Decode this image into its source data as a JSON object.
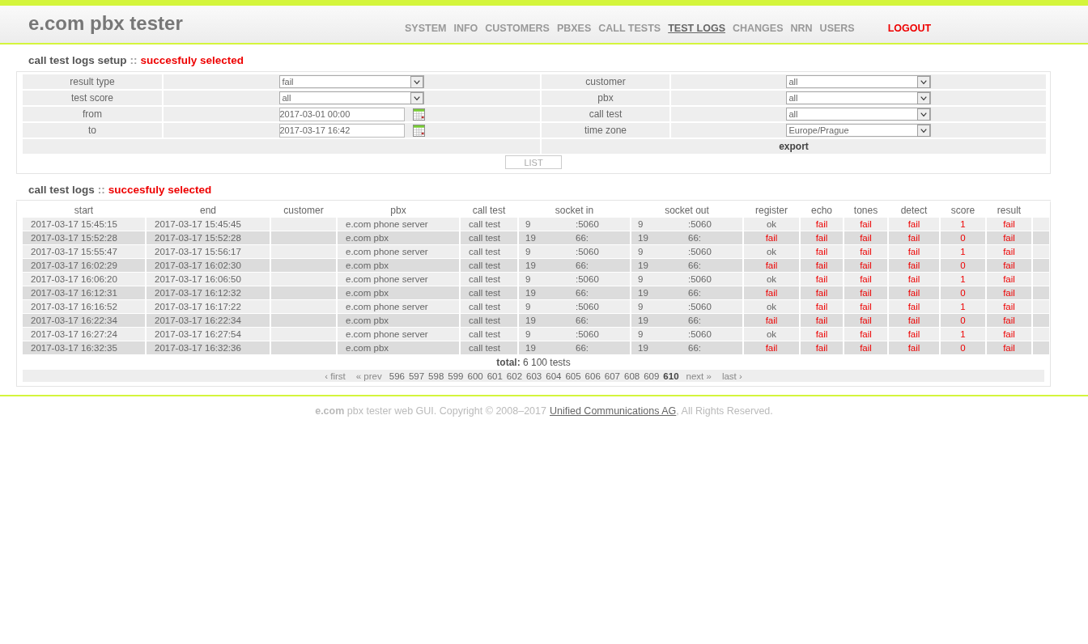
{
  "app_title": "e.com pbx tester",
  "nav": [
    {
      "label": "SYSTEM",
      "selected": false,
      "kind": "link"
    },
    {
      "label": "INFO",
      "selected": false,
      "kind": "link"
    },
    {
      "label": "CUSTOMERS",
      "selected": false,
      "kind": "link"
    },
    {
      "label": "PBXES",
      "selected": false,
      "kind": "link"
    },
    {
      "label": "CALL TESTS",
      "selected": false,
      "kind": "link"
    },
    {
      "label": "TEST LOGS",
      "selected": true,
      "kind": "link"
    },
    {
      "label": "CHANGES",
      "selected": false,
      "kind": "link"
    },
    {
      "label": "NRN",
      "selected": false,
      "kind": "link"
    },
    {
      "label": "USERS",
      "selected": false,
      "kind": "link"
    },
    {
      "label": "LOGOUT",
      "selected": false,
      "kind": "logout"
    }
  ],
  "setup": {
    "heading": "call test logs setup",
    "separator": "::",
    "status": "succesfuly selected",
    "left": [
      {
        "label": "result type",
        "kind": "select",
        "value": "fail"
      },
      {
        "label": "test score",
        "kind": "select",
        "value": "all"
      },
      {
        "label": "from",
        "kind": "date",
        "value": "2017-03-01 00:00"
      },
      {
        "label": "to",
        "kind": "date",
        "value": "2017-03-17 16:42"
      }
    ],
    "right": [
      {
        "label": "customer",
        "kind": "select",
        "value": "all"
      },
      {
        "label": "pbx",
        "kind": "select",
        "value": "all"
      },
      {
        "label": "call test",
        "kind": "select",
        "value": "all"
      },
      {
        "label": "time zone",
        "kind": "select",
        "value": "Europe/Prague"
      }
    ],
    "export": "export",
    "list_button": "LIST"
  },
  "logs": {
    "heading": "call test logs",
    "separator": "::",
    "status": "succesfuly selected",
    "columns": [
      "start",
      "end",
      "customer",
      "pbx",
      "call test",
      "socket in",
      "socket out",
      "register",
      "echo",
      "tones",
      "detect",
      "score",
      "result"
    ],
    "rows": [
      {
        "start": "2017-03-17 15:45:15",
        "end": "2017-03-17 15:45:45",
        "pbx": "e.com phone server",
        "call_test": "call test",
        "socket_in": [
          "9",
          ":5060"
        ],
        "socket_out": [
          "9",
          ":5060"
        ],
        "checks": [
          {
            "text": "ok",
            "failed": false
          },
          {
            "text": "fail",
            "failed": true
          },
          {
            "text": "fail",
            "failed": true
          },
          {
            "text": "fail",
            "failed": true
          },
          {
            "text": "1",
            "failed": true
          },
          {
            "text": "fail",
            "failed": true
          }
        ]
      },
      {
        "start": "2017-03-17 15:52:28",
        "end": "2017-03-17 15:52:28",
        "pbx": "e.com pbx",
        "call_test": "call test",
        "socket_in": [
          "19",
          "66:"
        ],
        "socket_out": [
          "19",
          "66:"
        ],
        "checks": [
          {
            "text": "fail",
            "failed": true
          },
          {
            "text": "fail",
            "failed": true
          },
          {
            "text": "fail",
            "failed": true
          },
          {
            "text": "fail",
            "failed": true
          },
          {
            "text": "0",
            "failed": true
          },
          {
            "text": "fail",
            "failed": true
          }
        ]
      },
      {
        "start": "2017-03-17 15:55:47",
        "end": "2017-03-17 15:56:17",
        "pbx": "e.com phone server",
        "call_test": "call test",
        "socket_in": [
          "9",
          ":5060"
        ],
        "socket_out": [
          "9",
          ":5060"
        ],
        "checks": [
          {
            "text": "ok",
            "failed": false
          },
          {
            "text": "fail",
            "failed": true
          },
          {
            "text": "fail",
            "failed": true
          },
          {
            "text": "fail",
            "failed": true
          },
          {
            "text": "1",
            "failed": true
          },
          {
            "text": "fail",
            "failed": true
          }
        ]
      },
      {
        "start": "2017-03-17 16:02:29",
        "end": "2017-03-17 16:02:30",
        "pbx": "e.com pbx",
        "call_test": "call test",
        "socket_in": [
          "19",
          "66:"
        ],
        "socket_out": [
          "19",
          "66:"
        ],
        "checks": [
          {
            "text": "fail",
            "failed": true
          },
          {
            "text": "fail",
            "failed": true
          },
          {
            "text": "fail",
            "failed": true
          },
          {
            "text": "fail",
            "failed": true
          },
          {
            "text": "0",
            "failed": true
          },
          {
            "text": "fail",
            "failed": true
          }
        ]
      },
      {
        "start": "2017-03-17 16:06:20",
        "end": "2017-03-17 16:06:50",
        "pbx": "e.com phone server",
        "call_test": "call test",
        "socket_in": [
          "9",
          ":5060"
        ],
        "socket_out": [
          "9",
          ":5060"
        ],
        "checks": [
          {
            "text": "ok",
            "failed": false
          },
          {
            "text": "fail",
            "failed": true
          },
          {
            "text": "fail",
            "failed": true
          },
          {
            "text": "fail",
            "failed": true
          },
          {
            "text": "1",
            "failed": true
          },
          {
            "text": "fail",
            "failed": true
          }
        ]
      },
      {
        "start": "2017-03-17 16:12:31",
        "end": "2017-03-17 16:12:32",
        "pbx": "e.com pbx",
        "call_test": "call test",
        "socket_in": [
          "19",
          "66:"
        ],
        "socket_out": [
          "19",
          "66:"
        ],
        "checks": [
          {
            "text": "fail",
            "failed": true
          },
          {
            "text": "fail",
            "failed": true
          },
          {
            "text": "fail",
            "failed": true
          },
          {
            "text": "fail",
            "failed": true
          },
          {
            "text": "0",
            "failed": true
          },
          {
            "text": "fail",
            "failed": true
          }
        ]
      },
      {
        "start": "2017-03-17 16:16:52",
        "end": "2017-03-17 16:17:22",
        "pbx": "e.com phone server",
        "call_test": "call test",
        "socket_in": [
          "9",
          ":5060"
        ],
        "socket_out": [
          "9",
          ":5060"
        ],
        "checks": [
          {
            "text": "ok",
            "failed": false
          },
          {
            "text": "fail",
            "failed": true
          },
          {
            "text": "fail",
            "failed": true
          },
          {
            "text": "fail",
            "failed": true
          },
          {
            "text": "1",
            "failed": true
          },
          {
            "text": "fail",
            "failed": true
          }
        ]
      },
      {
        "start": "2017-03-17 16:22:34",
        "end": "2017-03-17 16:22:34",
        "pbx": "e.com pbx",
        "call_test": "call test",
        "socket_in": [
          "19",
          "66:"
        ],
        "socket_out": [
          "19",
          "66:"
        ],
        "checks": [
          {
            "text": "fail",
            "failed": true
          },
          {
            "text": "fail",
            "failed": true
          },
          {
            "text": "fail",
            "failed": true
          },
          {
            "text": "fail",
            "failed": true
          },
          {
            "text": "0",
            "failed": true
          },
          {
            "text": "fail",
            "failed": true
          }
        ]
      },
      {
        "start": "2017-03-17 16:27:24",
        "end": "2017-03-17 16:27:54",
        "pbx": "e.com phone server",
        "call_test": "call test",
        "socket_in": [
          "9",
          ":5060"
        ],
        "socket_out": [
          "9",
          ":5060"
        ],
        "checks": [
          {
            "text": "ok",
            "failed": false
          },
          {
            "text": "fail",
            "failed": true
          },
          {
            "text": "fail",
            "failed": true
          },
          {
            "text": "fail",
            "failed": true
          },
          {
            "text": "1",
            "failed": true
          },
          {
            "text": "fail",
            "failed": true
          }
        ]
      },
      {
        "start": "2017-03-17 16:32:35",
        "end": "2017-03-17 16:32:36",
        "pbx": "e.com pbx",
        "call_test": "call test",
        "socket_in": [
          "19",
          "66:"
        ],
        "socket_out": [
          "19",
          "66:"
        ],
        "checks": [
          {
            "text": "fail",
            "failed": true
          },
          {
            "text": "fail",
            "failed": true
          },
          {
            "text": "fail",
            "failed": true
          },
          {
            "text": "fail",
            "failed": true
          },
          {
            "text": "0",
            "failed": true
          },
          {
            "text": "fail",
            "failed": true
          }
        ]
      }
    ],
    "total": "**total:** 6 100 tests",
    "pager": {
      "first": "‹ first",
      "prev": "« prev",
      "pages": [
        {
          "label": "596",
          "selected": false
        },
        {
          "label": "597",
          "selected": false
        },
        {
          "label": "598",
          "selected": false
        },
        {
          "label": "599",
          "selected": false
        },
        {
          "label": "600",
          "selected": false
        },
        {
          "label": "601",
          "selected": false
        },
        {
          "label": "602",
          "selected": false
        },
        {
          "label": "603",
          "selected": false
        },
        {
          "label": "604",
          "selected": false
        },
        {
          "label": "605",
          "selected": false
        },
        {
          "label": "606",
          "selected": false
        },
        {
          "label": "607",
          "selected": false
        },
        {
          "label": "608",
          "selected": false
        },
        {
          "label": "609",
          "selected": false
        },
        {
          "label": "610",
          "selected": true
        }
      ],
      "next": "next »",
      "last": "last ›"
    }
  },
  "footer": {
    "text": "**e.com** pbx tester web GUI. Copyright © 2008–2017",
    "link": "Unified Communications AG",
    "after": ", All Rights Reserved."
  }
}
